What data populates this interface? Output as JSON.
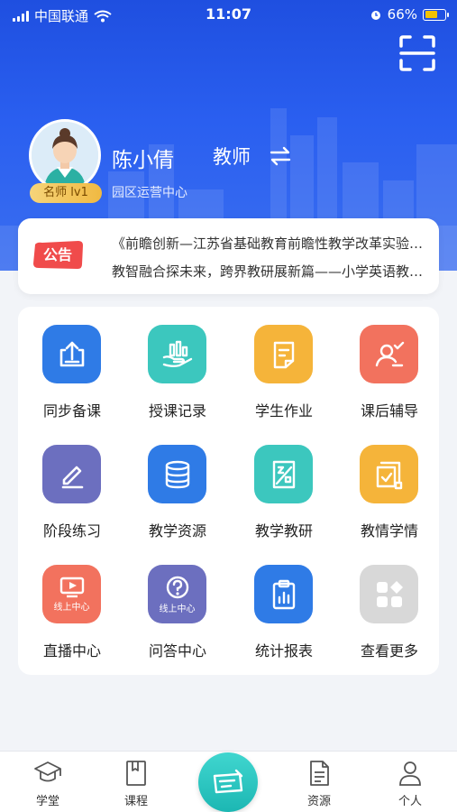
{
  "status_bar": {
    "carrier": "中国联通",
    "time": "11:07",
    "battery": "66%",
    "battery_level": 0.66
  },
  "profile": {
    "name": "陈小倩",
    "role": "教师",
    "badge": "名师 lv1",
    "org": "园区运营中心"
  },
  "notice": {
    "tag": "公告",
    "lines": [
      "《前瞻创新—江苏省基础教育前瞻性教学改革实验项目",
      "教智融合探未来，跨界教研展新篇——小学英语教研活动"
    ]
  },
  "features": [
    {
      "label": "同步备课",
      "icon": "upload-doc-icon",
      "color": "#2f7be6"
    },
    {
      "label": "授课记录",
      "icon": "record-chart-icon",
      "color": "#3cc7be"
    },
    {
      "label": "学生作业",
      "icon": "homework-icon",
      "color": "#f5b43a"
    },
    {
      "label": "课后辅导",
      "icon": "tutor-icon",
      "color": "#f2725e"
    },
    {
      "label": "阶段练习",
      "icon": "pencil-icon",
      "color": "#6c6fbf"
    },
    {
      "label": "教学资源",
      "icon": "database-icon",
      "color": "#2f7be6"
    },
    {
      "label": "教学教研",
      "icon": "research-icon",
      "color": "#3cc7be"
    },
    {
      "label": "教情学情",
      "icon": "analysis-icon",
      "color": "#f5b43a"
    },
    {
      "label": "直播中心",
      "icon": "live-icon",
      "color": "#f2725e",
      "sub": "线上中心"
    },
    {
      "label": "问答中心",
      "icon": "question-icon",
      "color": "#6c6fbf",
      "sub": "线上中心"
    },
    {
      "label": "统计报表",
      "icon": "report-icon",
      "color": "#2f7be6"
    },
    {
      "label": "查看更多",
      "icon": "more-grid-icon",
      "color": "#d8d8d8"
    }
  ],
  "tabs": [
    {
      "label": "学堂",
      "icon": "graduation-cap-icon"
    },
    {
      "label": "课程",
      "icon": "book-icon"
    },
    {
      "label": "",
      "icon": "center-action-icon"
    },
    {
      "label": "资源",
      "icon": "document-icon"
    },
    {
      "label": "个人",
      "icon": "person-icon"
    }
  ]
}
